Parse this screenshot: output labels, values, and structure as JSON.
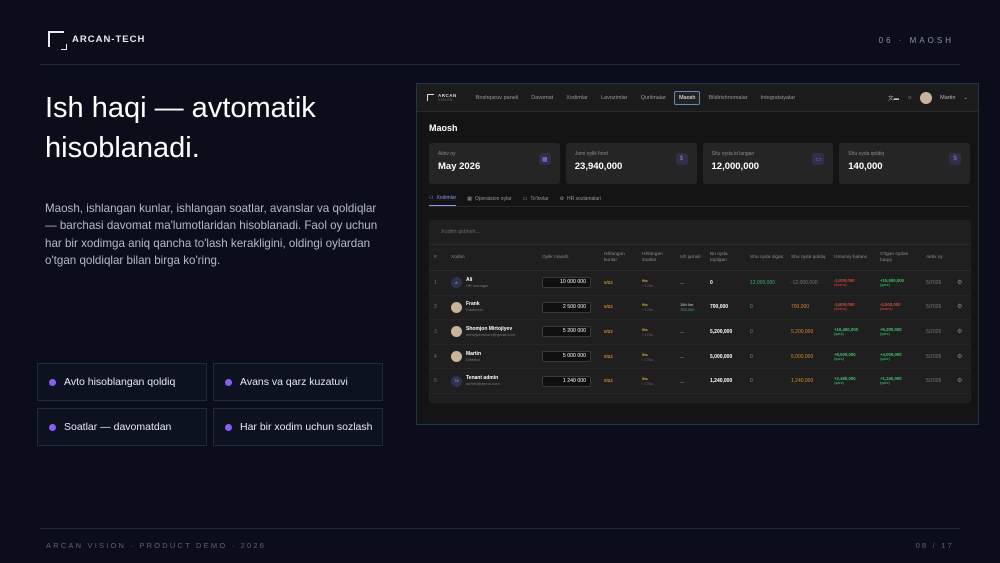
{
  "brand": "ARCAN-TECH",
  "section_tag": "06 · MAOSH",
  "headline": "Ish haqi — avtomatik hisoblanadi.",
  "description": "Maosh, ishlangan kunlar, ishlangan soatlar, avanslar va qoldiqlar — barchasi davomat ma'lumotlaridan hisoblanadi. Faol oy uchun har bir xodimga aniq qancha to'lash kerakligini, oldingi oylardan o'tgan qoldiqlar bilan birga ko'ring.",
  "features": [
    "Avto hisoblangan qoldiq",
    "Avans va qarz kuzatuvi",
    "Soatlar — davomatdan",
    "Har bir xodim uchun sozlash"
  ],
  "footer_left": "ARCAN VISION · PRODUCT DEMO · 2026",
  "footer_right": "08 / 17",
  "app": {
    "logo_top": "ARCAN",
    "logo_bottom": "VISION",
    "nav": [
      "Boshqaruv paneli",
      "Davomat",
      "Xodimlar",
      "Lavozimlar",
      "Qurilmalar",
      "Maosh",
      "Bildirishnomalar",
      "Integratsiyalar"
    ],
    "active_nav": 5,
    "user": "Martin",
    "page_title": "Maosh",
    "cards": [
      {
        "label": "Aktiv oy",
        "value": "May 2026"
      },
      {
        "label": "Jami oylik fond",
        "value": "23,940,000"
      },
      {
        "label": "Shu oyda to'langan",
        "value": "12,000,000"
      },
      {
        "label": "Shu oyda qoldiq",
        "value": "140,000"
      }
    ],
    "subtabs": [
      "Xodimlar",
      "Operatsion oylar",
      "To'lovlar",
      "HR sozlamalari"
    ],
    "search_placeholder": "Xodim qidirish...",
    "columns": [
      "#",
      "Xodim",
      "Oylik maosh",
      "Ishlangan kunlar",
      "Ishlangan soatlar",
      "Ish jurnali",
      "Bu oyda topilgan",
      "Shu oyda olgan",
      "Shu oyda qoldiq",
      "Umumiy balans",
      "O'tgan oydan haqqi",
      "Aktiv oy",
      ""
    ],
    "rows": [
      {
        "n": "1",
        "initial": "A",
        "name": "Ali",
        "role": "HR manager",
        "salary": "10 000 000",
        "days": "0/22",
        "hours": "0ts",
        "hours_sub": "/ 176s",
        "journal": "—",
        "journal_sub": "",
        "earned": "0",
        "received": "12,000,000",
        "remain": "-12,000,000",
        "balance": "-2,000,000",
        "balance_sub": "(avans)",
        "prev": "+10,000,000",
        "prev_sub": "(qarz)",
        "month": "5/2026"
      },
      {
        "n": "2",
        "initial": "",
        "name": "Frank",
        "role": "Dasturchi",
        "salary": "2 500 000",
        "days": "0/22",
        "hours": "0ts",
        "hours_sub": "/ 176s",
        "journal": "15h 0m",
        "journal_sub": "700,000",
        "earned": "700,000",
        "received": "0",
        "remain": "700,000",
        "balance": "-3,800,000",
        "balance_sub": "(avans)",
        "prev": "-4,500,000",
        "prev_sub": "(avans)",
        "month": "5/2026"
      },
      {
        "n": "3",
        "initial": "",
        "name": "Shomjon Mirtojiyev",
        "role": "mirtojiyevshom@gmail.com",
        "salary": "5 200 000",
        "days": "0/22",
        "hours": "0ts",
        "hours_sub": "/ 176s",
        "journal": "—",
        "journal_sub": "",
        "earned": "5,200,000",
        "received": "0",
        "remain": "5,200,000",
        "balance": "+10,400,000",
        "balance_sub": "(qarz)",
        "prev": "+5,200,000",
        "prev_sub": "(qarz)",
        "month": "5/2026"
      },
      {
        "n": "4",
        "initial": "",
        "name": "Martin",
        "role": "Direktor",
        "salary": "5 000 000",
        "days": "0/22",
        "hours": "0ts",
        "hours_sub": "/ 176s",
        "journal": "—",
        "journal_sub": "",
        "earned": "5,000,000",
        "received": "0",
        "remain": "5,000,000",
        "balance": "+8,000,000",
        "balance_sub": "(qarz)",
        "prev": "+4,000,000",
        "prev_sub": "(qarz)",
        "month": "5/2026"
      },
      {
        "n": "5",
        "initial": "TA",
        "name": "Tenant admin",
        "role": "admin@demo.com",
        "salary": "1 240 000",
        "days": "0/22",
        "hours": "0ts",
        "hours_sub": "/ 176s",
        "journal": "—",
        "journal_sub": "",
        "earned": "1,240,000",
        "received": "0",
        "remain": "1,240,000",
        "balance": "+2,480,000",
        "balance_sub": "(qarz)",
        "prev": "+1,240,000",
        "prev_sub": "(qarz)",
        "month": "5/2026"
      }
    ]
  }
}
